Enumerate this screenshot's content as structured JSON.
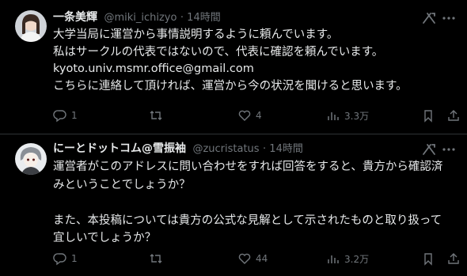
{
  "tweets": [
    {
      "name": "一条美輝",
      "handle": "@miki_ichizyo",
      "time": "· 14時間",
      "lines": [
        "大学当局に運営から事情説明するように頼んでいます。",
        "私はサークルの代表ではないので、代表に確認を頼んでいます。",
        "kyoto.univ.msmr.office@gmail.com",
        "こちらに連絡して頂ければ、運営から今の状況を聞けると思います。"
      ],
      "replies": "1",
      "retweets": "",
      "likes": "4",
      "views": "3.3万"
    },
    {
      "name": "にーとドットコム@雪振袖",
      "handle": "@zucristatus",
      "time": "· 14時間",
      "lines": [
        "運営者がこのアドレスに問い合わせをすれば回答をすると、貴方から確認済",
        "みということでしょうか？",
        "",
        "また、本投稿については貴方の公式な見解として示されたものと取り扱って",
        "宜しいでしょうか？"
      ],
      "replies": "1",
      "retweets": "",
      "likes": "44",
      "views": "3.2万"
    }
  ],
  "colors": {
    "background": "#000000",
    "text": "#e7e9ea",
    "muted": "#71767b",
    "divider": "#2f3336"
  },
  "icons": [
    "reply-icon",
    "retweet-icon",
    "like-icon",
    "views-icon",
    "bookmark-icon",
    "share-icon",
    "grok-icon",
    "more-icon"
  ]
}
